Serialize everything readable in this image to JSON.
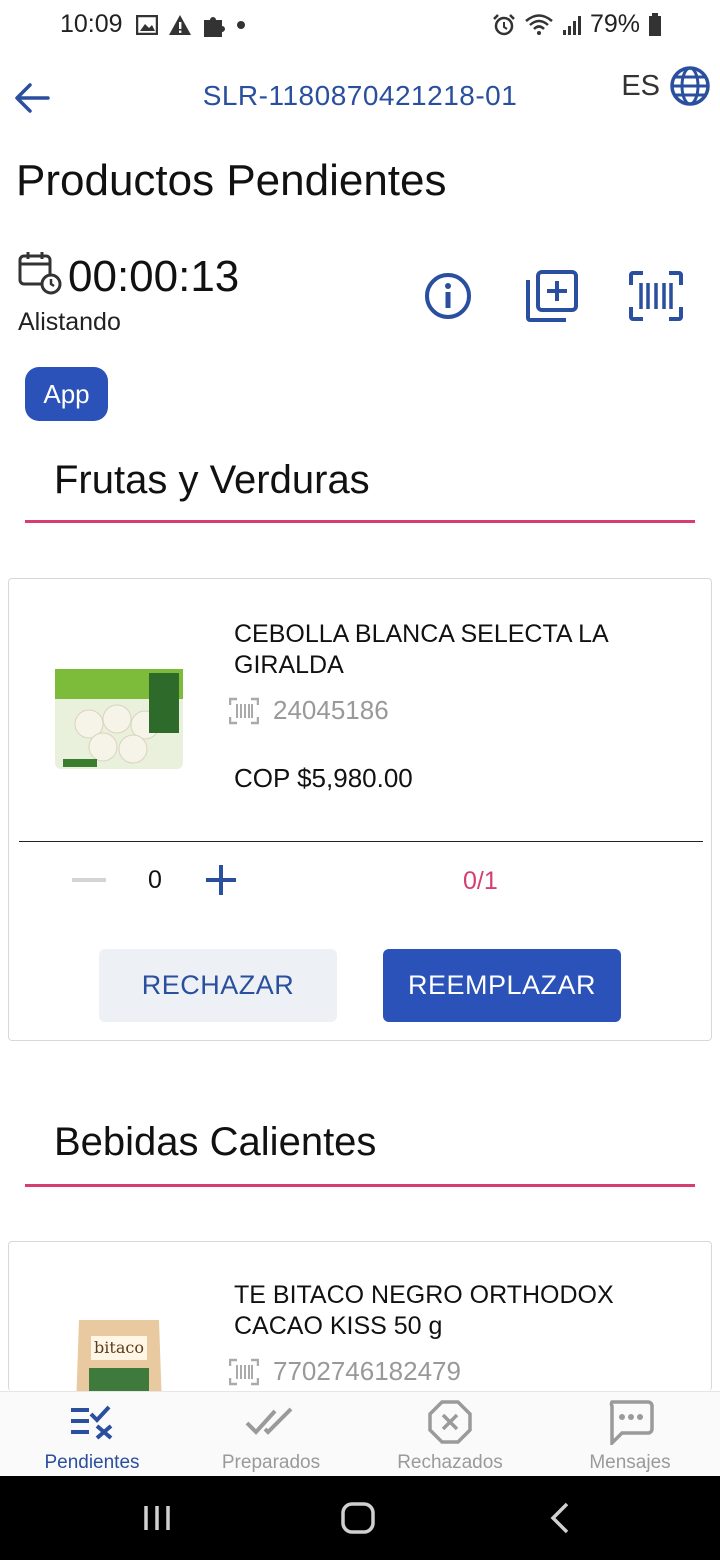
{
  "status_bar": {
    "time": "10:09",
    "battery": "79%"
  },
  "header": {
    "order_id": "SLR-1180870421218-01",
    "language": "ES"
  },
  "page_title": "Productos Pendientes",
  "timer": {
    "value": "00:00:13",
    "state": "Alistando"
  },
  "chip": {
    "label": "App"
  },
  "colors": {
    "primary": "#2a52b8",
    "accent": "#d63d72",
    "muted": "#9a9a9a"
  },
  "sections": [
    {
      "title": "Frutas y Verduras",
      "product": {
        "name": "CEBOLLA BLANCA SELECTA LA GIRALDA",
        "code": "24045186",
        "price": "COP $5,980.00",
        "quantity": "0",
        "progress": "0/1",
        "reject_label": "RECHAZAR",
        "replace_label": "REEMPLAZAR"
      }
    },
    {
      "title": "Bebidas Calientes",
      "product": {
        "name": "TE BITACO NEGRO ORTHODOX CACAO KISS 50 g",
        "code": "7702746182479"
      }
    }
  ],
  "bottom_nav": [
    {
      "label": "Pendientes",
      "icon": "pending-list-icon",
      "active": true
    },
    {
      "label": "Preparados",
      "icon": "double-check-icon",
      "active": false
    },
    {
      "label": "Rechazados",
      "icon": "rejected-octagon-icon",
      "active": false
    },
    {
      "label": "Mensajes",
      "icon": "message-bubble-icon",
      "active": false
    }
  ]
}
